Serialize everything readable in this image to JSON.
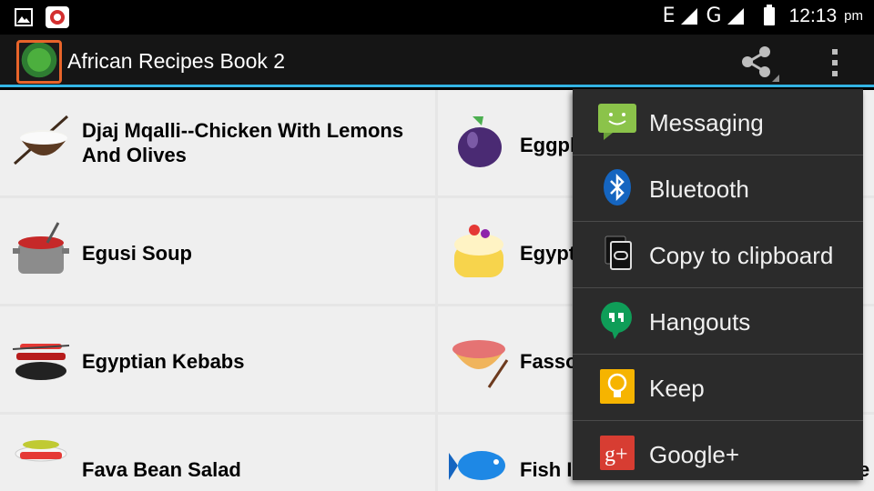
{
  "status_bar": {
    "network_e": "E",
    "network_g": "G",
    "time": "12:13",
    "ampm": "pm",
    "icons": [
      "gallery-icon",
      "app-notification-icon",
      "signal-icon",
      "battery-icon"
    ]
  },
  "action_bar": {
    "title": "African Recipes Book 2",
    "icons": [
      "app-logo-icon",
      "share-icon",
      "overflow-menu-icon"
    ],
    "accent_color": "#33b5e5"
  },
  "recipes": {
    "left": [
      {
        "label_line1": "Djaj Mqalli--Chicken With Lemons",
        "label_line2": "And Olives",
        "icon": "rice-bowl-icon"
      },
      {
        "label": "Egusi Soup",
        "icon": "soup-pot-icon"
      },
      {
        "label": "Egyptian Kebabs",
        "icon": "kebab-grill-icon"
      },
      {
        "label": "Fava Bean Salad",
        "icon": "salad-plate-icon"
      }
    ],
    "right": [
      {
        "label": "Eggpl",
        "icon": "eggplant-icon"
      },
      {
        "label": "Egypt",
        "icon": "cake-icon"
      },
      {
        "label": "Fasso",
        "icon": "noodle-bowl-icon"
      },
      {
        "label": "Fish I",
        "icon": "fish-icon"
      }
    ],
    "right_edge_fragment": "e"
  },
  "share_menu": {
    "items": [
      {
        "label": "Messaging",
        "icon": "messaging-icon"
      },
      {
        "label": "Bluetooth",
        "icon": "bluetooth-icon"
      },
      {
        "label": "Copy to clipboard",
        "icon": "clipboard-icon"
      },
      {
        "label": "Hangouts",
        "icon": "hangouts-icon"
      },
      {
        "label": "Keep",
        "icon": "keep-icon"
      },
      {
        "label": "Google+",
        "icon": "google-plus-icon"
      }
    ]
  }
}
